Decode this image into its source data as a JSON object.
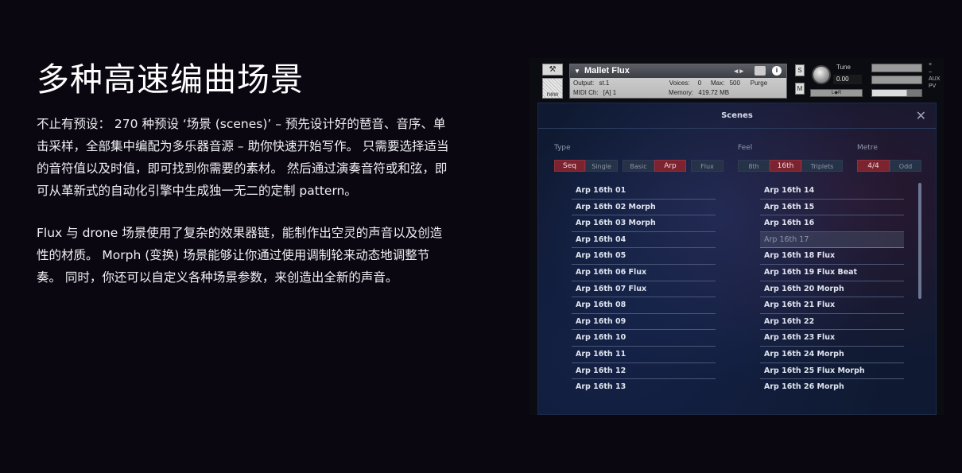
{
  "text": {
    "heading": "多种高速编曲场景",
    "para1": "不止有预设： 270 种预设 ‘场景 (scenes)’ – 预先设计好的琶音、音序、单击采样，全部集中编配为多乐器音源 – 助你快速开始写作。 只需要选择适当的音符值以及时值，即可找到你需要的素材。 然后通过演奏音符或和弦，即可从革新式的自动化引擎中生成独一无二的定制 pattern。",
    "para2": "Flux 与 drone 场景使用了复杂的效果器链，能制作出空灵的声音以及创造性的材质。 Morph (变换) 场景能够让你通过使用调制轮来动态地调整节奏。 同时，你还可以自定义各种场景参数，来创造出全新的声音。"
  },
  "kontakt": {
    "instrument_name": "Mallet Flux",
    "new_label": "new",
    "output_label": "Output:",
    "output_value": "st.1",
    "voices_label": "Voices:",
    "voices_value": "0",
    "max_label": "Max:",
    "max_value": "500",
    "purge_label": "Purge",
    "midi_label": "MIDI Ch:",
    "midi_value": "[A]  1",
    "memory_label": "Memory:",
    "memory_value": "419.72 MB",
    "s_label": "S",
    "m_label": "M",
    "tune_label": "Tune",
    "tune_value": "0.00",
    "aux_label": "AUX",
    "pv_label": "PV",
    "nav_arrows": "◂ ▸",
    "lr_label": "L◆R"
  },
  "scenes": {
    "title": "Scenes",
    "close": "✕",
    "type_label": "Type",
    "feel_label": "Feel",
    "metre_label": "Metre",
    "type_buttons": [
      {
        "label": "Seq",
        "active": true
      },
      {
        "label": "Single",
        "active": false
      },
      {
        "label": "Basic",
        "active": false
      },
      {
        "label": "Arp",
        "active": true
      },
      {
        "label": "Flux",
        "active": false
      }
    ],
    "feel_buttons": [
      {
        "label": "8th",
        "active": false
      },
      {
        "label": "16th",
        "active": true
      },
      {
        "label": "Triplets",
        "active": false
      }
    ],
    "metre_buttons": [
      {
        "label": "4/4",
        "active": true
      },
      {
        "label": "Odd",
        "active": false
      }
    ],
    "left_list": [
      "Arp 16th 01",
      "Arp 16th 02 Morph",
      "Arp 16th 03 Morph",
      "Arp 16th 04",
      "Arp 16th 05",
      "Arp 16th 06 Flux",
      "Arp 16th 07 Flux",
      "Arp 16th 08",
      "Arp 16th 09",
      "Arp 16th 10",
      "Arp 16th 11",
      "Arp 16th 12",
      "Arp 16th 13"
    ],
    "right_list": [
      "Arp 16th 14",
      "Arp 16th 15",
      "Arp 16th 16",
      "Arp 16th 17",
      "Arp 16th 18 Flux",
      "Arp 16th 19 Flux Beat",
      "Arp 16th 20 Morph",
      "Arp 16th 21 Flux",
      "Arp 16th 22",
      "Arp 16th 23 Flux",
      "Arp 16th 24 Morph",
      "Arp 16th 25 Flux Morph",
      "Arp 16th 26 Morph"
    ],
    "selected_item": "Arp 16th 17"
  }
}
